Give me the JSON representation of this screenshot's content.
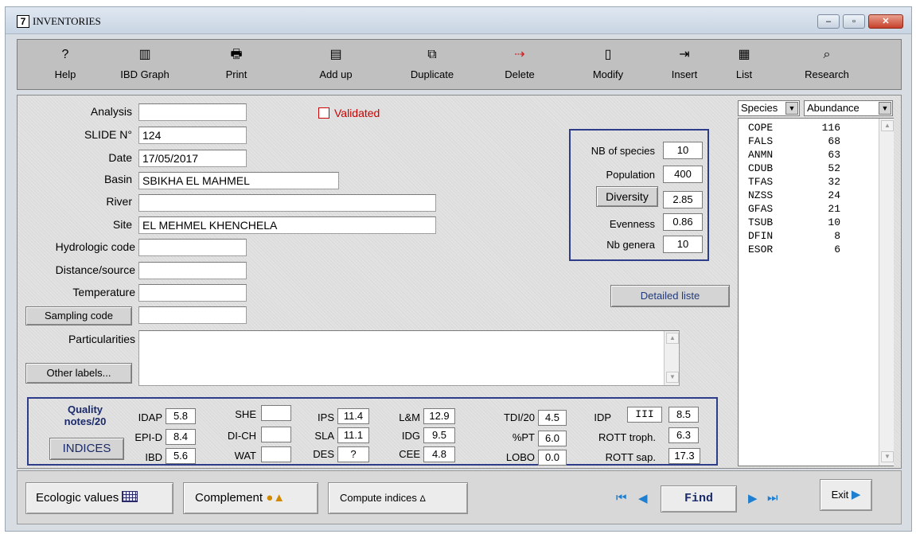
{
  "window": {
    "title_icon": "7",
    "title": "INVENTORIES",
    "min_label": "–",
    "max_label": "▫",
    "close_label": "✕"
  },
  "toolbar": [
    {
      "label": "Help",
      "icon": "?"
    },
    {
      "label": "IBD Graph",
      "icon": "▥"
    },
    {
      "label": "Print",
      "icon": "🖶"
    },
    {
      "label": "Add up",
      "icon": "▤"
    },
    {
      "label": "Duplicate",
      "icon": "⧉"
    },
    {
      "label": "Delete",
      "icon": "⇢"
    },
    {
      "label": "Modify",
      "icon": "▯"
    },
    {
      "label": "Insert",
      "icon": "⇥"
    },
    {
      "label": "List",
      "icon": "▦"
    },
    {
      "label": "Research",
      "icon": "⌕"
    }
  ],
  "form": {
    "analysis_label": "Analysis",
    "analysis_value": "",
    "slide_label": "SLIDE N°",
    "slide_value": "124",
    "date_label": "Date",
    "date_value": "17/05/2017",
    "basin_label": "Basin",
    "basin_value": "SBIKHA EL MAHMEL",
    "river_label": "River",
    "river_value": "",
    "site_label": "Site",
    "site_value": "EL MEHMEL KHENCHELA",
    "hydro_label": "Hydrologic code",
    "hydro_value": "",
    "distance_label": "Distance/source",
    "distance_value": "",
    "temperature_label": "Temperature",
    "temperature_value": "",
    "sampling_label": "Sampling code",
    "sampling_value": "",
    "particularities_label": "Particularities",
    "particularities_value": "",
    "other_labels_label": "Other labels...",
    "validated_label": "Validated",
    "validated_checked": false
  },
  "stats": {
    "nb_species_label": "NB of species",
    "nb_species_value": "10",
    "population_label": "Population",
    "population_value": "400",
    "diversity_label": "Diversity",
    "diversity_value": "2.85",
    "evenness_label": "Evenness",
    "evenness_value": "0.86",
    "nb_genera_label": "Nb genera",
    "nb_genera_value": "10",
    "detailed_label": "Detailed liste"
  },
  "indices": {
    "quality_label": "Quality notes/20",
    "indices_button": "INDICES",
    "idap_label": "IDAP",
    "idap": "5.8",
    "epid_label": "EPI-D",
    "epid": "8.4",
    "ibd_label": "IBD",
    "ibd": "5.6",
    "she_label": "SHE",
    "she": "",
    "dich_label": "DI-CH",
    "dich": "",
    "wat_label": "WAT",
    "wat": "",
    "ips_label": "IPS",
    "ips": "11.4",
    "sla_label": "SLA",
    "sla": "11.1",
    "des_label": "DES",
    "des": "?",
    "lm_label": "L&M",
    "lm": "12.9",
    "idg_label": "IDG",
    "idg": "9.5",
    "cee_label": "CEE",
    "cee": "4.8",
    "tdi_label": "TDI/20",
    "tdi": "4.5",
    "pt_label": "%PT",
    "pt": "6.0",
    "lobo_label": "LOBO",
    "lobo": "0.0",
    "idp_label": "IDP",
    "idp_class": "III",
    "idp": "8.5",
    "rott_troph_label": "ROTT troph.",
    "rott_troph": "6.3",
    "rott_sap_label": "ROTT sap.",
    "rott_sap": "17.3"
  },
  "species_list": {
    "col1_label": "Species",
    "col2_label": "Abundance",
    "rows": [
      {
        "code": "COPE",
        "abundance": "116"
      },
      {
        "code": "FALS",
        "abundance": "68"
      },
      {
        "code": "ANMN",
        "abundance": "63"
      },
      {
        "code": "CDUB",
        "abundance": "52"
      },
      {
        "code": "TFAS",
        "abundance": "32"
      },
      {
        "code": "NZSS",
        "abundance": "24"
      },
      {
        "code": "GFAS",
        "abundance": "21"
      },
      {
        "code": "TSUB",
        "abundance": "10"
      },
      {
        "code": "DFIN",
        "abundance": "8"
      },
      {
        "code": "ESOR",
        "abundance": "6"
      }
    ]
  },
  "bottom": {
    "ecologic_label": "Ecologic values",
    "complement_label": "Complement",
    "compute_label": "Compute indices",
    "find_label": "Find",
    "exit_label": "Exit"
  },
  "colors": {
    "accent_blue": "#2e3d8a",
    "validated_red": "#cc0000",
    "nav_blue": "#1e7fd0"
  }
}
